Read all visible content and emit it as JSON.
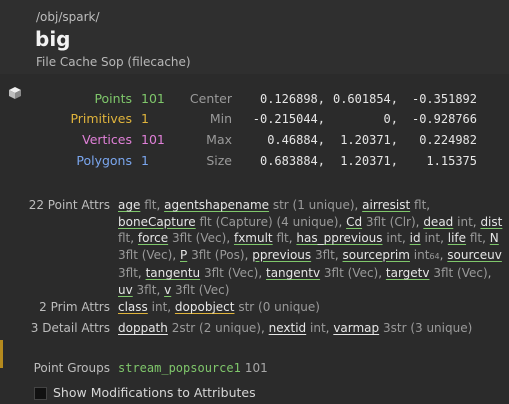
{
  "header": {
    "path": "/obj/spark/",
    "node_name": "big",
    "node_type": "File Cache Sop (filecache)"
  },
  "counts": [
    {
      "label": "Points",
      "value": "101",
      "color": "#7fc76b"
    },
    {
      "label": "Primitives",
      "value": "1",
      "color": "#e0b43c"
    },
    {
      "label": "Vertices",
      "value": "101",
      "color": "#e080d8"
    },
    {
      "label": "Polygons",
      "value": "1",
      "color": "#7aa6ee"
    }
  ],
  "bounds": [
    {
      "label": "Center",
      "v1": "0.126898,",
      "v2": "0.601854,",
      "v3": "-0.351892"
    },
    {
      "label": "Min",
      "v1": "-0.215044,",
      "v2": "0,",
      "v3": "-0.928766"
    },
    {
      "label": "Max",
      "v1": "0.46884,",
      "v2": "1.20371,",
      "v3": "0.224982"
    },
    {
      "label": "Size",
      "v1": "0.683884,",
      "v2": "1.20371,",
      "v3": "1.15375"
    }
  ],
  "point_attrs": {
    "label": "22 Point Attrs",
    "items": [
      {
        "name": "age",
        "type": "flt"
      },
      {
        "name": "agentshapename",
        "type": "str (1 unique)"
      },
      {
        "name": "airresist",
        "type": "flt"
      },
      {
        "name": "boneCapture",
        "type": "flt (Capture) (4 unique)"
      },
      {
        "name": "Cd",
        "type": "3flt (Clr)"
      },
      {
        "name": "dead",
        "type": "int"
      },
      {
        "name": "dist",
        "type": "flt"
      },
      {
        "name": "force",
        "type": "3flt (Vec)"
      },
      {
        "name": "fxmult",
        "type": "flt"
      },
      {
        "name": "has_pprevious",
        "type": "int"
      },
      {
        "name": "id",
        "type": "int"
      },
      {
        "name": "life",
        "type": "flt"
      },
      {
        "name": "N",
        "type": "3flt (Vec)"
      },
      {
        "name": "P",
        "type": "3flt (Pos)"
      },
      {
        "name": "pprevious",
        "type": "3flt"
      },
      {
        "name": "sourceprim",
        "type": "int",
        "sub": "64"
      },
      {
        "name": "sourceuv",
        "type": "3flt"
      },
      {
        "name": "tangentu",
        "type": "3flt (Vec)"
      },
      {
        "name": "tangentv",
        "type": "3flt (Vec)"
      },
      {
        "name": "targetv",
        "type": "3flt (Vec)"
      },
      {
        "name": "uv",
        "type": "3flt"
      },
      {
        "name": "v",
        "type": "3flt (Vec)"
      }
    ]
  },
  "prim_attrs": {
    "label": "2 Prim Attrs",
    "items": [
      {
        "name": "class",
        "type": "int"
      },
      {
        "name": "dopobject",
        "type": "str (0 unique)"
      }
    ]
  },
  "detail_attrs": {
    "label": "3 Detail Attrs",
    "items": [
      {
        "name": "doppath",
        "type": "2str (2 unique)"
      },
      {
        "name": "nextid",
        "type": "int"
      },
      {
        "name": "varmap",
        "type": "3str (3 unique)"
      }
    ]
  },
  "groups": {
    "label": "Point Groups",
    "name": "stream_popsource1",
    "count": "101"
  },
  "footer": {
    "checkbox_label": "Show Modifications to Attributes",
    "checked": false
  },
  "colors": {
    "points": "#7fc76b",
    "primitives": "#e0b43c",
    "vertices": "#e080d8",
    "polygons": "#7aa6ee"
  }
}
